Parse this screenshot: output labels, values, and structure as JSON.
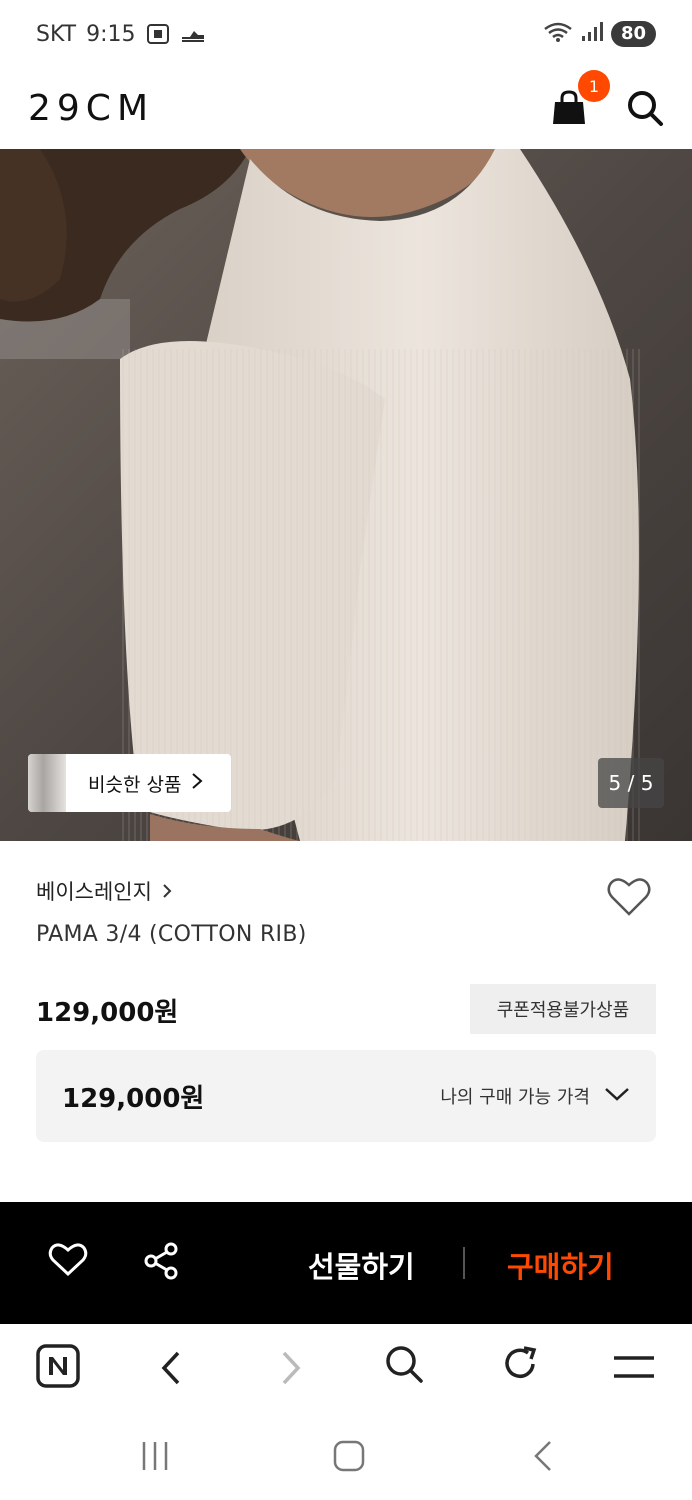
{
  "status_bar": {
    "carrier": "SKT",
    "time": "9:15",
    "battery": "80"
  },
  "header": {
    "logo": "29CM",
    "cart_count": "1"
  },
  "hero": {
    "similar_label": "비슷한 상품",
    "counter": "5 / 5"
  },
  "product": {
    "brand": "베이스레인지",
    "name": "PAMA 3/4 (COTTON RIB)",
    "price": "129,000원",
    "coupon_badge": "쿠폰적용불가상품"
  },
  "my_price": {
    "price": "129,000원",
    "label": "나의 구매 가능 가격"
  },
  "action_bar": {
    "gift_label": "선물하기",
    "buy_label": "구매하기"
  },
  "colors": {
    "accent": "#ff4800",
    "dark": "#000000",
    "panel": "#f3f3f3"
  }
}
